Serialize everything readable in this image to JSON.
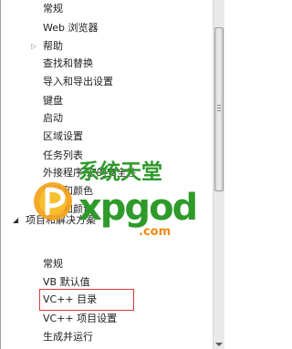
{
  "tree": {
    "items": [
      {
        "label": "常规",
        "level": 1
      },
      {
        "label": "Web 浏览器",
        "level": 1
      },
      {
        "label": "帮助",
        "level": 1,
        "expander": "collapsed"
      },
      {
        "label": "查找和替换",
        "level": 1
      },
      {
        "label": "导入和导出设置",
        "level": 1
      },
      {
        "label": "键盘",
        "level": 1
      },
      {
        "label": "启动",
        "level": 1
      },
      {
        "label": "区域设置",
        "level": 1
      },
      {
        "label": "任务列表",
        "level": 1
      },
      {
        "label": "外接程序/宏的安全性",
        "level": 1
      },
      {
        "label": "字体和颜色",
        "level": 1
      },
      {
        "label": "文本和颜色",
        "level": 1
      },
      {
        "label": "项目和解决方案",
        "level": 0,
        "expander": "expanded"
      },
      {
        "label": "常规",
        "level": 1
      },
      {
        "label": "VB 默认值",
        "level": 1
      },
      {
        "label": "VC++ 目录",
        "level": 1,
        "selected": true
      },
      {
        "label": "VC++ 项目设置",
        "level": 1
      },
      {
        "label": "生成并运行",
        "level": 1
      }
    ]
  },
  "watermark": {
    "title": "系统天堂",
    "brand": "xpgod",
    "domain": ".com"
  },
  "colors": {
    "highlight": "#d23b3b",
    "watermark_green": "#2e9a2a",
    "watermark_orange": "#f08a12"
  }
}
